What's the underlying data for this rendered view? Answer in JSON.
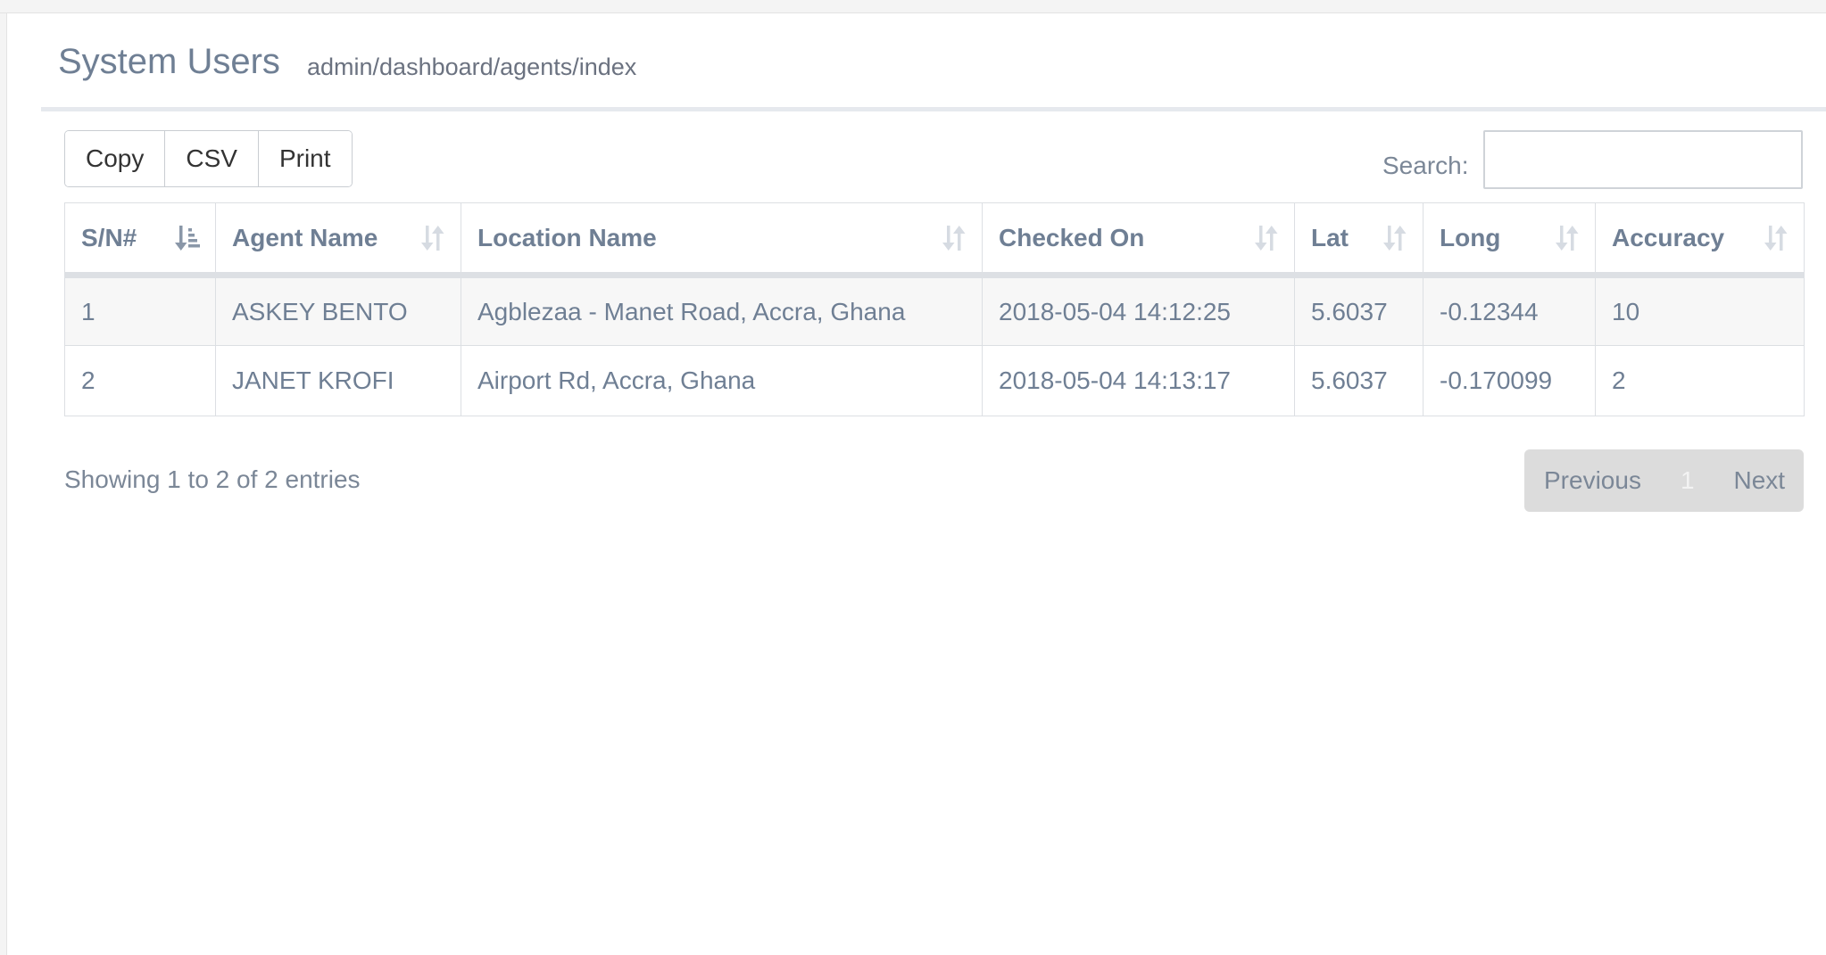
{
  "header": {
    "title": "System Users",
    "breadcrumb": "admin/dashboard/agents/index"
  },
  "toolbar": {
    "buttons": [
      "Copy",
      "CSV",
      "Print"
    ],
    "search_label": "Search:",
    "search_value": "",
    "search_placeholder": ""
  },
  "table": {
    "columns": [
      "S/N#",
      "Agent Name",
      "Location Name",
      "Checked On",
      "Lat",
      "Long",
      "Accuracy"
    ],
    "sorted_column": "S/N#",
    "rows": [
      [
        "1",
        "ASKEY BENTO",
        "Agblezaa - Manet Road, Accra, Ghana",
        "2018-05-04 14:12:25",
        "5.6037",
        "-0.12344",
        "10"
      ],
      [
        "2",
        "JANET KROFI",
        "Airport Rd, Accra, Ghana",
        "2018-05-04 14:13:17",
        "5.6037",
        "-0.170099",
        "2"
      ]
    ]
  },
  "footer": {
    "info": "Showing 1 to 2 of 2 entries",
    "pagination": {
      "previous": "Previous",
      "current": "1",
      "next": "Next"
    }
  },
  "colors": {
    "accent_text": "#6f7f94",
    "row_stripe": "#f7f7f7",
    "pagination_bg": "#dcdcdc"
  },
  "icons": {
    "sorted": "sort-amount-asc-icon",
    "sortable": "sort-both-icon"
  }
}
